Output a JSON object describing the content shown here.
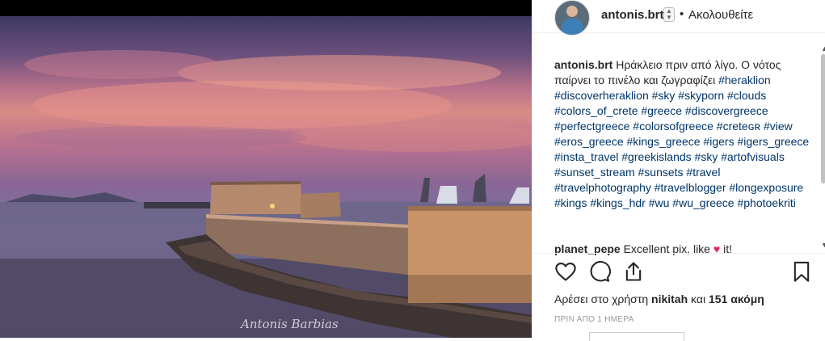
{
  "post": {
    "username": "antonis.brt",
    "dot": "•",
    "follow_label": "Ακολουθείτε",
    "signature": "Antonis Barbias",
    "caption_user": "antonis.brt",
    "caption_text": "Ηράκλειο πριν από λίγο. Ο νότος παίρνει το πινέλο και ζωγραφίζει",
    "caption_tags": "#heraklion #discoverheraklion #sky #skyporn #clouds #colors_of_crete #greece #discovergreece #perfectgreece #colorsofgreece #creteɢʀ #view #eros_greece #kings_greece #igers #igers_greece #insta_travel #greekislands #sky #artofvisuals #sunset_stream #sunsets #travel #travelphotography #travelblogger #longexposure #kings #kings_hdr #wu #wu_greece #photoekriti",
    "comment2_user": "planet_pepe",
    "comment2_text": "Excellent pix, like",
    "comment2_suffix": "it!",
    "likes_prefix": "Αρέσει στο χρήστη",
    "likes_user": "nikitah",
    "likes_mid": "και",
    "likes_count": "151 ακόμη",
    "time": "ΠΡΙΝ ΑΠΟ 1 ΗΜΕΡΑ"
  },
  "icons": {
    "heart": "heart-icon",
    "comment": "comment-icon",
    "share": "share-icon",
    "save": "bookmark-icon"
  }
}
